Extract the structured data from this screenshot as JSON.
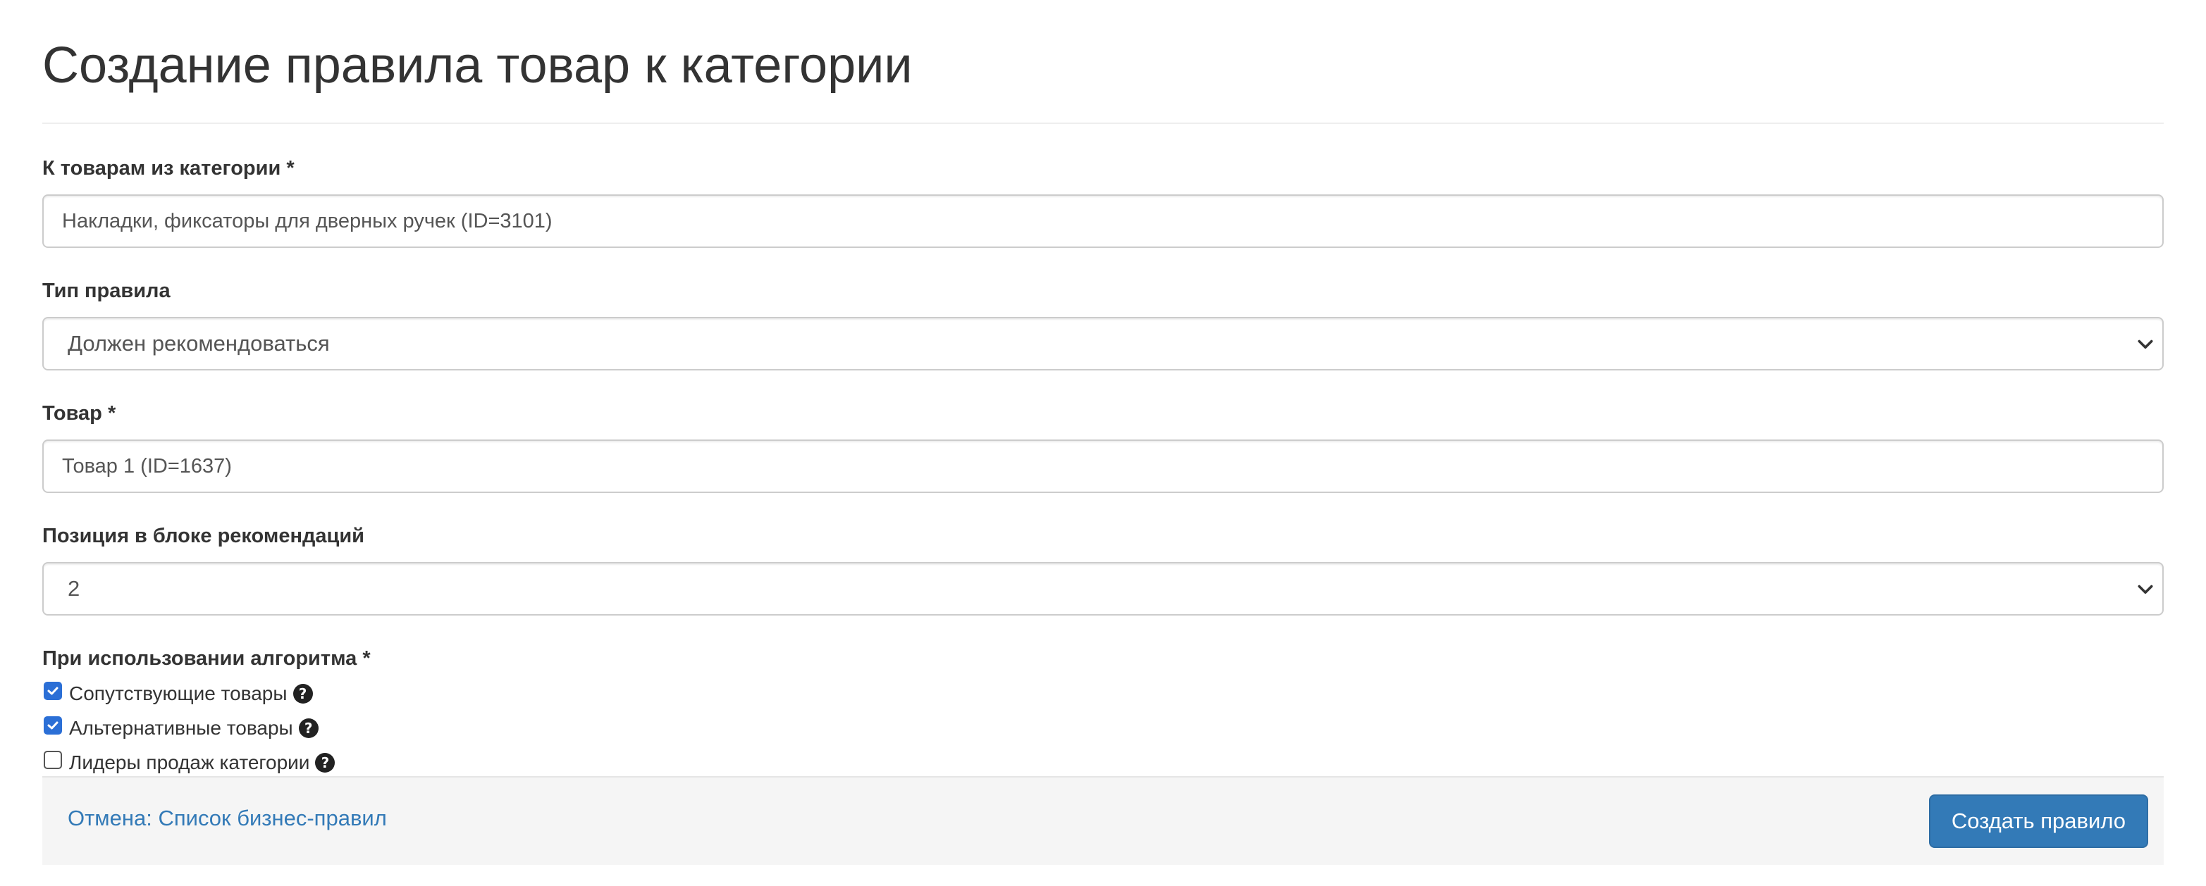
{
  "page": {
    "title": "Создание правила товар к категории"
  },
  "form": {
    "category": {
      "label": "К товарам из категории *",
      "value": "Накладки, фиксаторы для дверных ручек (ID=3101)"
    },
    "rule_type": {
      "label": "Тип правила",
      "selected": "Должен рекомендоваться"
    },
    "product": {
      "label": "Товар *",
      "value": "Товар 1 (ID=1637)"
    },
    "position": {
      "label": "Позиция в блоке рекомендаций",
      "selected": "2"
    },
    "algorithm": {
      "label": "При использовании алгоритма *",
      "options": [
        {
          "label": "Сопутствующие товары",
          "checked": true,
          "icon": "question-circle-icon"
        },
        {
          "label": "Альтернативные товары",
          "checked": true,
          "icon": "question-circle-icon"
        },
        {
          "label": "Лидеры продаж категории",
          "checked": false,
          "icon": "question-circle-icon"
        }
      ]
    }
  },
  "footer": {
    "cancel_label": "Отмена: Список бизнес-правил",
    "submit_label": "Создать правило"
  },
  "colors": {
    "link": "#337ab7",
    "primary_button": "#337ab7",
    "checkbox_checked": "#2b6fd6",
    "footer_bg": "#f5f5f5"
  }
}
